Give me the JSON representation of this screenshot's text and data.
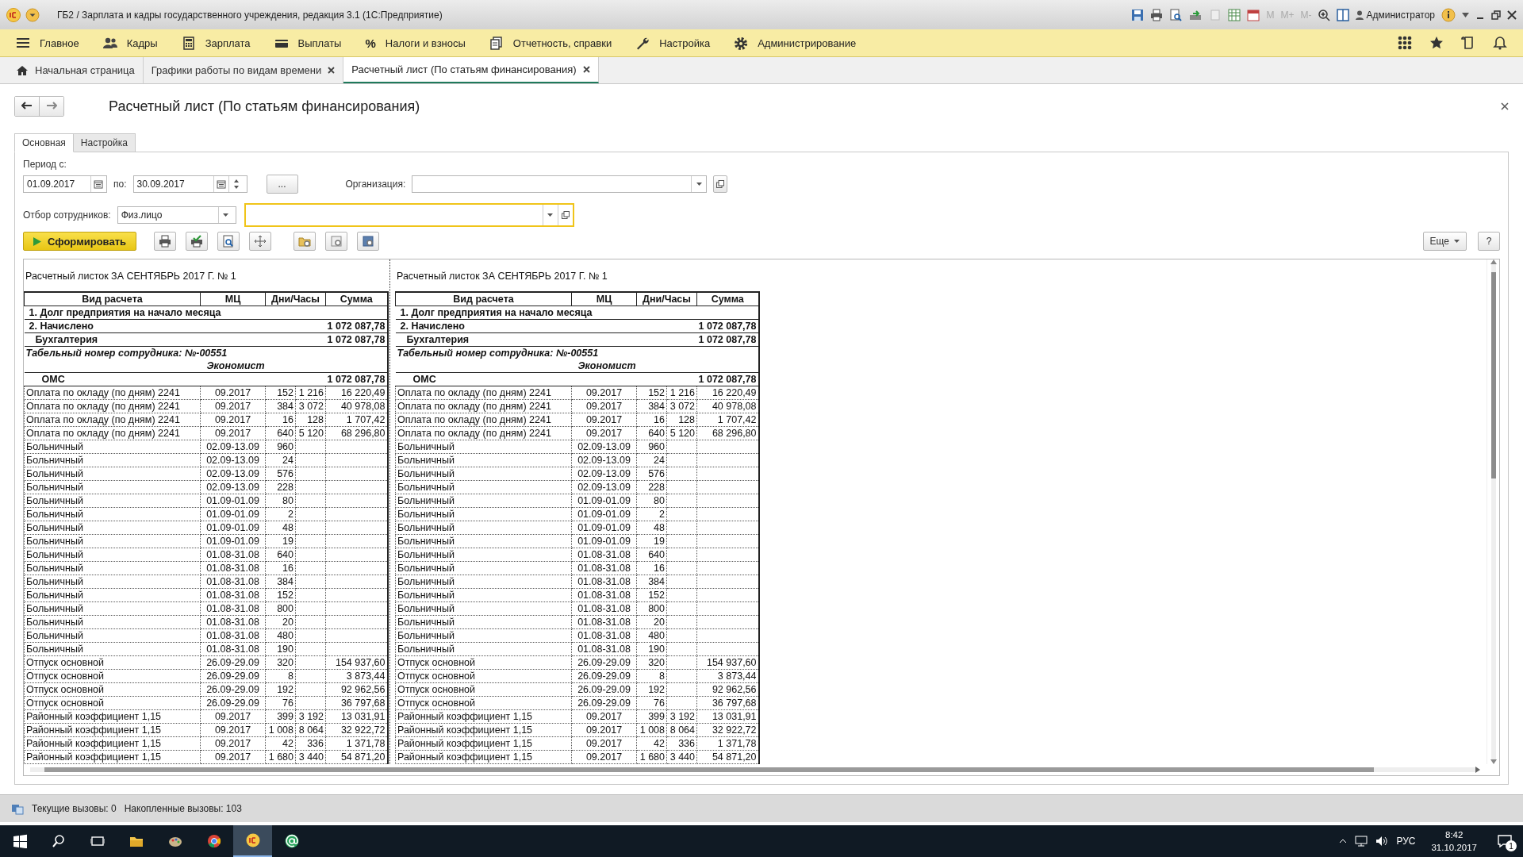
{
  "window": {
    "title": "ГБ2 / Зарплата и кадры государственного учреждения, редакция 3.1 (1С:Предприятие)",
    "memory_buttons": [
      "M",
      "M+",
      "M-"
    ],
    "user": "Администратор"
  },
  "main_menu": [
    {
      "label": "Главное"
    },
    {
      "label": "Кадры"
    },
    {
      "label": "Зарплата"
    },
    {
      "label": "Выплаты"
    },
    {
      "label": "Налоги и взносы",
      "symbol": "%"
    },
    {
      "label": "Отчетность, справки"
    },
    {
      "label": "Настройка"
    },
    {
      "label": "Администрирование"
    }
  ],
  "open_tabs": [
    {
      "label": "Начальная страница",
      "kind": "home",
      "selected": false
    },
    {
      "label": "Графики работы по видам времени",
      "kind": "document",
      "selected": false
    },
    {
      "label": "Расчетный лист (По статьям финансирования)",
      "kind": "document",
      "selected": true
    }
  ],
  "form": {
    "title": "Расчетный лист (По статьям финансирования)",
    "tabs": [
      {
        "label": "Основная",
        "selected": true
      },
      {
        "label": "Настройка",
        "selected": false
      }
    ],
    "period_label": "Период с:",
    "date_from": "01.09.2017",
    "to_label": "по:",
    "date_to": "30.09.2017",
    "period_button": "...",
    "organization_label": "Организация:",
    "employee_filter_label": "Отбор сотрудников:",
    "employee_filter_type": "Физ.лицо",
    "generate_button": "Сформировать",
    "more_button": "Еще",
    "help_button": "?"
  },
  "reports": [
    {
      "title": "Расчетный листок ЗА СЕНТЯБРЬ 2017 Г. № 1",
      "columns": [
        "Вид расчета",
        "МЦ",
        "Дни/Часы",
        "Сумма"
      ],
      "rows": [
        {
          "kind": "total",
          "label": "1. Долг предприятия на начало месяца"
        },
        {
          "kind": "total",
          "label": "2. Начислено",
          "sum": "1 072 087,78"
        },
        {
          "kind": "department",
          "label": "Бухгалтерия",
          "sum": "1 072 087,78"
        },
        {
          "kind": "employee",
          "label": "Табельный номер сотрудника: №-00551",
          "position": "Экономист"
        },
        {
          "kind": "fund",
          "label": "ОМС",
          "sum": "1 072 087,78"
        },
        {
          "kind": "line",
          "label": "Оплата по окладу (по дням) 2241",
          "mc": "09.2017",
          "days": "152",
          "hours": "1 216",
          "sum": "16 220,49"
        },
        {
          "kind": "line",
          "label": "Оплата по окладу (по дням) 2241",
          "mc": "09.2017",
          "days": "384",
          "hours": "3 072",
          "sum": "40 978,08"
        },
        {
          "kind": "line",
          "label": "Оплата по окладу (по дням) 2241",
          "mc": "09.2017",
          "days": "16",
          "hours": "128",
          "sum": "1 707,42"
        },
        {
          "kind": "line",
          "label": "Оплата по окладу (по дням) 2241",
          "mc": "09.2017",
          "days": "640",
          "hours": "5 120",
          "sum": "68 296,80"
        },
        {
          "kind": "line",
          "label": "Больничный",
          "mc": "02.09-13.09",
          "days": "960"
        },
        {
          "kind": "line",
          "label": "Больничный",
          "mc": "02.09-13.09",
          "days": "24"
        },
        {
          "kind": "line",
          "label": "Больничный",
          "mc": "02.09-13.09",
          "days": "576"
        },
        {
          "kind": "line",
          "label": "Больничный",
          "mc": "02.09-13.09",
          "days": "228"
        },
        {
          "kind": "line",
          "label": "Больничный",
          "mc": "01.09-01.09",
          "days": "80"
        },
        {
          "kind": "line",
          "label": "Больничный",
          "mc": "01.09-01.09",
          "days": "2"
        },
        {
          "kind": "line",
          "label": "Больничный",
          "mc": "01.09-01.09",
          "days": "48"
        },
        {
          "kind": "line",
          "label": "Больничный",
          "mc": "01.09-01.09",
          "days": "19"
        },
        {
          "kind": "line",
          "label": "Больничный",
          "mc": "01.08-31.08",
          "days": "640"
        },
        {
          "kind": "line",
          "label": "Больничный",
          "mc": "01.08-31.08",
          "days": "16"
        },
        {
          "kind": "line",
          "label": "Больничный",
          "mc": "01.08-31.08",
          "days": "384"
        },
        {
          "kind": "line",
          "label": "Больничный",
          "mc": "01.08-31.08",
          "days": "152"
        },
        {
          "kind": "line",
          "label": "Больничный",
          "mc": "01.08-31.08",
          "days": "800"
        },
        {
          "kind": "line",
          "label": "Больничный",
          "mc": "01.08-31.08",
          "days": "20"
        },
        {
          "kind": "line",
          "label": "Больничный",
          "mc": "01.08-31.08",
          "days": "480"
        },
        {
          "kind": "line",
          "label": "Больничный",
          "mc": "01.08-31.08",
          "days": "190"
        },
        {
          "kind": "line",
          "label": "Отпуск основной",
          "mc": "26.09-29.09",
          "days": "320",
          "sum": "154 937,60"
        },
        {
          "kind": "line",
          "label": "Отпуск основной",
          "mc": "26.09-29.09",
          "days": "8",
          "sum": "3 873,44"
        },
        {
          "kind": "line",
          "label": "Отпуск основной",
          "mc": "26.09-29.09",
          "days": "192",
          "sum": "92 962,56"
        },
        {
          "kind": "line",
          "label": "Отпуск основной",
          "mc": "26.09-29.09",
          "days": "76",
          "sum": "36 797,68"
        },
        {
          "kind": "line",
          "label": "Районный коэффициент 1,15",
          "mc": "09.2017",
          "days": "399",
          "hours": "3 192",
          "sum": "13 031,91"
        },
        {
          "kind": "line",
          "label": "Районный коэффициент 1,15",
          "mc": "09.2017",
          "days": "1 008",
          "hours": "8 064",
          "sum": "32 922,72"
        },
        {
          "kind": "line",
          "label": "Районный коэффициент 1,15",
          "mc": "09.2017",
          "days": "42",
          "hours": "336",
          "sum": "1 371,78"
        },
        {
          "kind": "line",
          "label": "Районный коэффициент 1,15",
          "mc": "09.2017",
          "days": "1 680",
          "hours": "3 440",
          "sum": "54 871,20"
        }
      ]
    },
    {
      "title": "Расчетный листок ЗА СЕНТЯБРЬ 2017 Г. № 1",
      "columns": [
        "Вид расчета",
        "МЦ",
        "Дни/Часы",
        "Сумма"
      ],
      "rows": [
        {
          "kind": "total",
          "label": "1. Долг предприятия на начало месяца"
        },
        {
          "kind": "total",
          "label": "2. Начислено",
          "sum": "1 072 087,78"
        },
        {
          "kind": "department",
          "label": "Бухгалтерия",
          "sum": "1 072 087,78"
        },
        {
          "kind": "employee",
          "label": "Табельный номер сотрудника: №-00551",
          "position": "Экономист"
        },
        {
          "kind": "fund",
          "label": "ОМС",
          "sum": "1 072 087,78"
        },
        {
          "kind": "line",
          "label": "Оплата по окладу (по дням) 2241",
          "mc": "09.2017",
          "days": "152",
          "hours": "1 216",
          "sum": "16 220,49"
        },
        {
          "kind": "line",
          "label": "Оплата по окладу (по дням) 2241",
          "mc": "09.2017",
          "days": "384",
          "hours": "3 072",
          "sum": "40 978,08"
        },
        {
          "kind": "line",
          "label": "Оплата по окладу (по дням) 2241",
          "mc": "09.2017",
          "days": "16",
          "hours": "128",
          "sum": "1 707,42"
        },
        {
          "kind": "line",
          "label": "Оплата по окладу (по дням) 2241",
          "mc": "09.2017",
          "days": "640",
          "hours": "5 120",
          "sum": "68 296,80"
        },
        {
          "kind": "line",
          "label": "Больничный",
          "mc": "02.09-13.09",
          "days": "960"
        },
        {
          "kind": "line",
          "label": "Больничный",
          "mc": "02.09-13.09",
          "days": "24"
        },
        {
          "kind": "line",
          "label": "Больничный",
          "mc": "02.09-13.09",
          "days": "576"
        },
        {
          "kind": "line",
          "label": "Больничный",
          "mc": "02.09-13.09",
          "days": "228"
        },
        {
          "kind": "line",
          "label": "Больничный",
          "mc": "01.09-01.09",
          "days": "80"
        },
        {
          "kind": "line",
          "label": "Больничный",
          "mc": "01.09-01.09",
          "days": "2"
        },
        {
          "kind": "line",
          "label": "Больничный",
          "mc": "01.09-01.09",
          "days": "48"
        },
        {
          "kind": "line",
          "label": "Больничный",
          "mc": "01.09-01.09",
          "days": "19"
        },
        {
          "kind": "line",
          "label": "Больничный",
          "mc": "01.08-31.08",
          "days": "640"
        },
        {
          "kind": "line",
          "label": "Больничный",
          "mc": "01.08-31.08",
          "days": "16"
        },
        {
          "kind": "line",
          "label": "Больничный",
          "mc": "01.08-31.08",
          "days": "384"
        },
        {
          "kind": "line",
          "label": "Больничный",
          "mc": "01.08-31.08",
          "days": "152"
        },
        {
          "kind": "line",
          "label": "Больничный",
          "mc": "01.08-31.08",
          "days": "800"
        },
        {
          "kind": "line",
          "label": "Больничный",
          "mc": "01.08-31.08",
          "days": "20"
        },
        {
          "kind": "line",
          "label": "Больничный",
          "mc": "01.08-31.08",
          "days": "480"
        },
        {
          "kind": "line",
          "label": "Больничный",
          "mc": "01.08-31.08",
          "days": "190"
        },
        {
          "kind": "line",
          "label": "Отпуск основной",
          "mc": "26.09-29.09",
          "days": "320",
          "sum": "154 937,60"
        },
        {
          "kind": "line",
          "label": "Отпуск основной",
          "mc": "26.09-29.09",
          "days": "8",
          "sum": "3 873,44"
        },
        {
          "kind": "line",
          "label": "Отпуск основной",
          "mc": "26.09-29.09",
          "days": "192",
          "sum": "92 962,56"
        },
        {
          "kind": "line",
          "label": "Отпуск основной",
          "mc": "26.09-29.09",
          "days": "76",
          "sum": "36 797,68"
        },
        {
          "kind": "line",
          "label": "Районный коэффициент 1,15",
          "mc": "09.2017",
          "days": "399",
          "hours": "3 192",
          "sum": "13 031,91"
        },
        {
          "kind": "line",
          "label": "Районный коэффициент 1,15",
          "mc": "09.2017",
          "days": "1 008",
          "hours": "8 064",
          "sum": "32 922,72"
        },
        {
          "kind": "line",
          "label": "Районный коэффициент 1,15",
          "mc": "09.2017",
          "days": "42",
          "hours": "336",
          "sum": "1 371,78"
        },
        {
          "kind": "line",
          "label": "Районный коэффициент 1,15",
          "mc": "09.2017",
          "days": "1 680",
          "hours": "3 440",
          "sum": "54 871,20"
        }
      ]
    }
  ],
  "status_bar": {
    "current_calls": "Текущие вызовы: 0",
    "accumulated_calls": "Накопленные вызовы: 103"
  },
  "taskbar": {
    "language": "РУС",
    "time": "8:42",
    "date": "31.10.2017",
    "notifications": "1"
  }
}
